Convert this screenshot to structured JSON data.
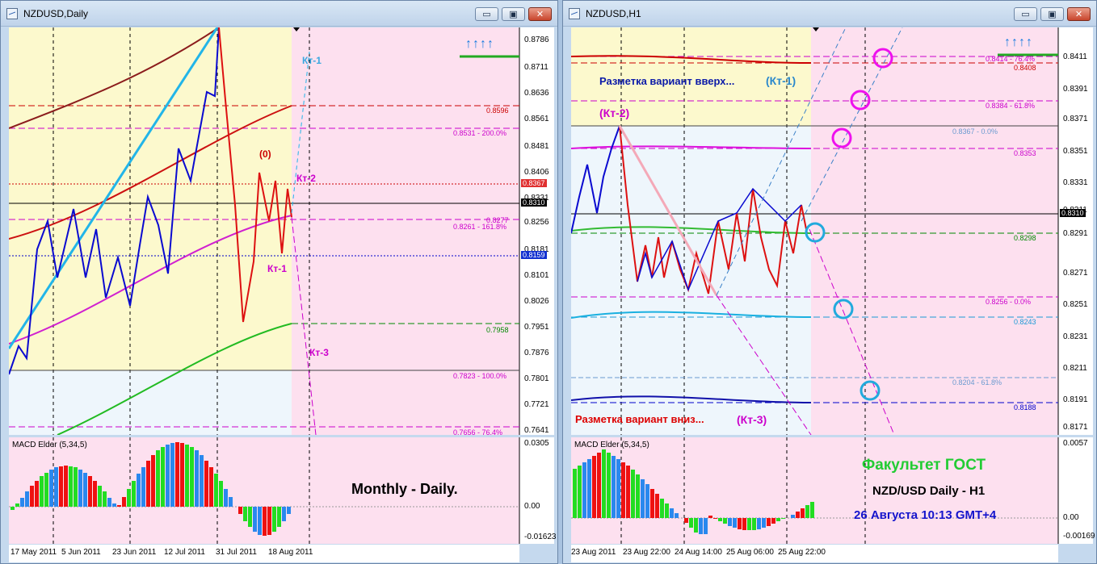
{
  "windows": [
    {
      "title": "NZDUSD,Daily",
      "buttons": {
        "minimize": "▭",
        "maximize": "▣",
        "close": "✕"
      },
      "y_labels": [
        "0.8786",
        "0.8711",
        "0.8636",
        "0.8561",
        "0.8481",
        "0.8406",
        "0.8331",
        "0.8256",
        "0.8181",
        "0.8101",
        "0.8026",
        "0.7951",
        "0.7876",
        "0.7801",
        "0.7721",
        "0.7641"
      ],
      "price_tags": [
        {
          "text": "0.8596",
          "color": "#cc0000"
        },
        {
          "text": "0.8531 - 200.0%",
          "color": "#cc00cc"
        },
        {
          "text": "0.8367",
          "color": "#cc0000",
          "boxed": true
        },
        {
          "text": "0.8310",
          "color": "#000000",
          "boxed": true
        },
        {
          "text": "0.8277",
          "color": "#cc00cc"
        },
        {
          "text": "0.8261 - 161.8%",
          "color": "#cc00cc"
        },
        {
          "text": "0.8159",
          "color": "#0000cc",
          "boxed": true
        },
        {
          "text": "0.7958",
          "color": "#008800"
        },
        {
          "text": "0.7823 - 100.0%",
          "color": "#cc00cc"
        },
        {
          "text": "0.7656 - 76.4%",
          "color": "#cc00cc"
        }
      ],
      "annotations": [
        "Кт-1",
        "Кт-2",
        "(0)",
        "Кт-1",
        "Кт-3"
      ],
      "arrows": "↑↑↑↑",
      "macd": {
        "title": "MACD Elder (5,34,5)",
        "labels": [
          "0.0305",
          "0.00",
          "-0.01623"
        ]
      },
      "overlay_text": "Monthly - Daily.",
      "x_labels": [
        "17 May 2011",
        "5 Jun 2011",
        "23 Jun 2011",
        "12 Jul 2011",
        "31 Jul 2011",
        "18 Aug 2011"
      ]
    },
    {
      "title": "NZDUSD,H1",
      "buttons": {
        "minimize": "▭",
        "maximize": "▣",
        "close": "✕"
      },
      "y_labels": [
        "0.8411",
        "0.8391",
        "0.8371",
        "0.8351",
        "0.8331",
        "0.8311",
        "0.8291",
        "0.8271",
        "0.8251",
        "0.8231",
        "0.8211",
        "0.8191",
        "0.8171"
      ],
      "price_tags": [
        {
          "text": "0.8414 - 76.4%",
          "color": "#cc00cc"
        },
        {
          "text": "0.8408",
          "color": "#cc0000"
        },
        {
          "text": "0.8384 - 61.8%",
          "color": "#cc00cc"
        },
        {
          "text": "0.8367 - 0.0%",
          "color": "#6a9ad0"
        },
        {
          "text": "0.8353",
          "color": "#cc00cc"
        },
        {
          "text": "0.8310",
          "color": "#000000",
          "boxed": true
        },
        {
          "text": "0.8298",
          "color": "#008800"
        },
        {
          "text": "0.8256 - 0.0%",
          "color": "#cc00cc"
        },
        {
          "text": "0.8243",
          "color": "#1a9ad6"
        },
        {
          "text": "0.8204 - 61.8%",
          "color": "#6a9ad0"
        },
        {
          "text": "0.8188",
          "color": "#0000cc"
        }
      ],
      "annotations": {
        "up_variant": "Разметка вариант вверх...",
        "kt1": "(Кт-1)",
        "kt2": "(Кт-2)",
        "down_variant": "Разметка вариант вниз...",
        "kt3": "(Кт-3)"
      },
      "arrows": "↑↑↑↑",
      "macd": {
        "title": "MACD Elder (5,34,5)",
        "labels": [
          "0.0057",
          "0.00",
          "-0.00169"
        ]
      },
      "overlay": {
        "faculty": "Факультет ГОСТ",
        "pair": "NZD/USD Daily - H1",
        "date": "26 Августа 10:13 GMT+4"
      },
      "x_labels": [
        "23 Aug 2011",
        "23 Aug 22:00",
        "24 Aug 14:00",
        "25 Aug 06:00",
        "25 Aug 22:00"
      ]
    }
  ]
}
